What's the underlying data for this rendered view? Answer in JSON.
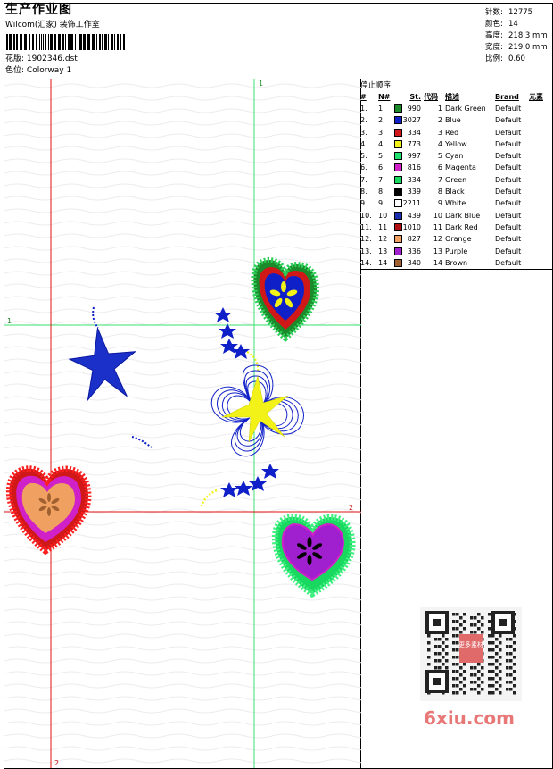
{
  "header": {
    "title": "生产作业图",
    "company": "Wilcom(汇家) 装饰工作室",
    "file_label": "花版:",
    "file_name": "1902346.dst",
    "colorway_label": "色位:",
    "colorway_name": "Colorway 1"
  },
  "stats": [
    {
      "label": "针数:",
      "value": "12775"
    },
    {
      "label": "颜色:",
      "value": "14"
    },
    {
      "label": "高度:",
      "value": "218.3 mm"
    },
    {
      "label": "宽度:",
      "value": "219.0 mm"
    },
    {
      "label": "比例:",
      "value": "0.60"
    }
  ],
  "stop_sequence": {
    "heading": "停止顺序:",
    "columns": [
      "#",
      "N#",
      "St.",
      "代码",
      "描述",
      "Brand",
      "元素"
    ],
    "rows": [
      {
        "idx": "1.",
        "n": "1",
        "color": "#1a8a2a",
        "st": "990",
        "code": "1",
        "desc": "Dark Green",
        "brand": "Default"
      },
      {
        "idx": "2.",
        "n": "2",
        "color": "#1020c8",
        "st": "3027",
        "code": "2",
        "desc": "Blue",
        "brand": "Default"
      },
      {
        "idx": "3.",
        "n": "3",
        "color": "#d01818",
        "st": "334",
        "code": "3",
        "desc": "Red",
        "brand": "Default"
      },
      {
        "idx": "4.",
        "n": "4",
        "color": "#f2f218",
        "st": "773",
        "code": "4",
        "desc": "Yellow",
        "brand": "Default"
      },
      {
        "idx": "5.",
        "n": "5",
        "color": "#20e070",
        "st": "997",
        "code": "5",
        "desc": "Cyan",
        "brand": "Default"
      },
      {
        "idx": "6.",
        "n": "6",
        "color": "#d020c8",
        "st": "816",
        "code": "6",
        "desc": "Magenta",
        "brand": "Default"
      },
      {
        "idx": "7.",
        "n": "7",
        "color": "#18d860",
        "st": "334",
        "code": "7",
        "desc": "Green",
        "brand": "Default"
      },
      {
        "idx": "8.",
        "n": "8",
        "color": "#000000",
        "st": "339",
        "code": "8",
        "desc": "Black",
        "brand": "Default"
      },
      {
        "idx": "9.",
        "n": "9",
        "color": "#ffffff",
        "st": "2211",
        "code": "9",
        "desc": "White",
        "brand": "Default"
      },
      {
        "idx": "10.",
        "n": "10",
        "color": "#1a30b0",
        "st": "439",
        "code": "10",
        "desc": "Dark Blue",
        "brand": "Default"
      },
      {
        "idx": "11.",
        "n": "11",
        "color": "#b01010",
        "st": "1010",
        "code": "11",
        "desc": "Dark Red",
        "brand": "Default"
      },
      {
        "idx": "12.",
        "n": "12",
        "color": "#f0a060",
        "st": "827",
        "code": "12",
        "desc": "Orange",
        "brand": "Default"
      },
      {
        "idx": "13.",
        "n": "13",
        "color": "#a020d0",
        "st": "336",
        "code": "13",
        "desc": "Purple",
        "brand": "Default"
      },
      {
        "idx": "14.",
        "n": "14",
        "color": "#a06030",
        "st": "340",
        "code": "14",
        "desc": "Brown",
        "brand": "Default"
      }
    ]
  },
  "guides": {
    "v1": "1",
    "h1": "1",
    "h2": "2",
    "v2": "2",
    "color_1": "#38e070",
    "color_2": "#e01010"
  },
  "watermark": "6xiu.com",
  "qr_stamp": "更多素材"
}
